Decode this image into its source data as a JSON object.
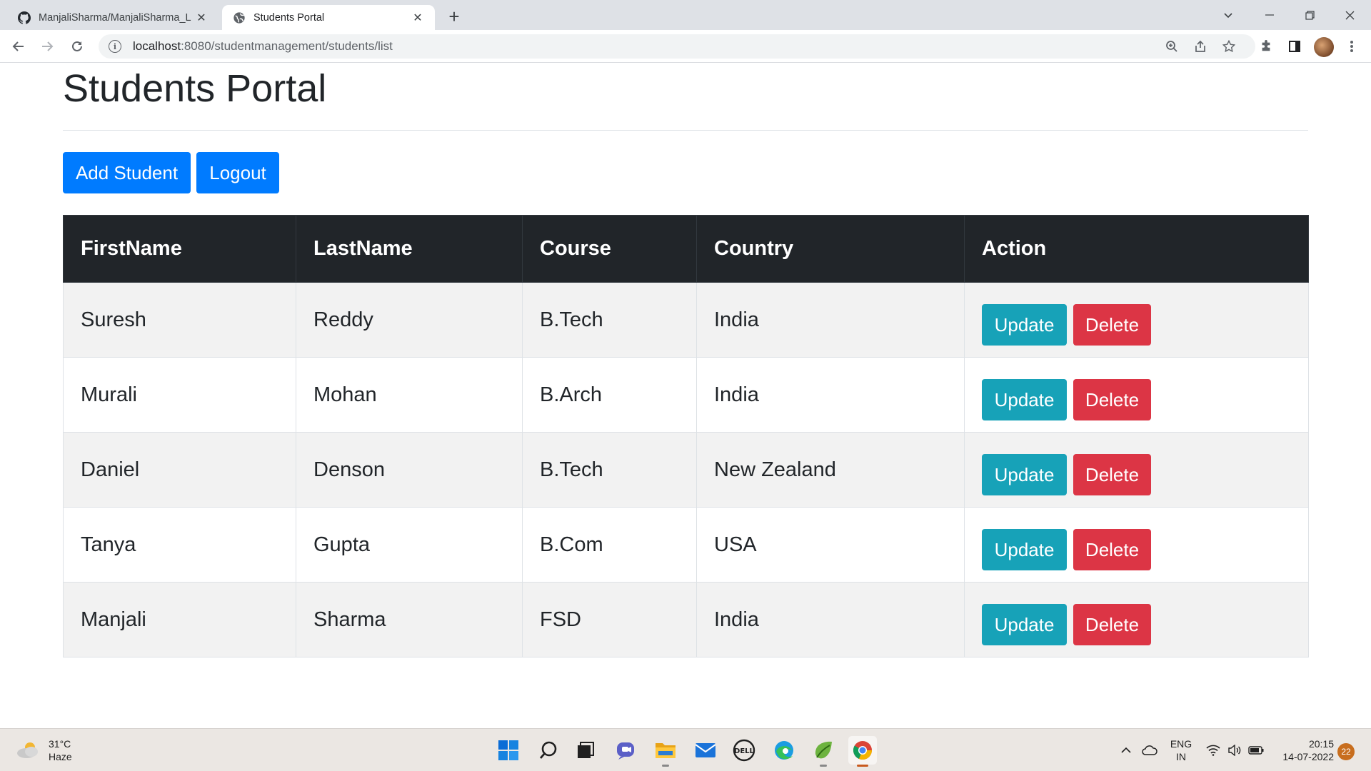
{
  "browser": {
    "tabs": [
      {
        "title": "ManjaliSharma/ManjaliSharma_L",
        "icon": "github-icon",
        "active": false
      },
      {
        "title": "Students Portal",
        "icon": "globe-icon",
        "active": true
      }
    ],
    "url_host": "localhost",
    "url_path": ":8080/studentmanagement/students/list"
  },
  "page": {
    "title": "Students Portal",
    "add_button": "Add Student",
    "logout_button": "Logout",
    "table": {
      "headers": [
        "FirstName",
        "LastName",
        "Course",
        "Country",
        "Action"
      ],
      "rows": [
        {
          "first": "Suresh",
          "last": "Reddy",
          "course": "B.Tech",
          "country": "India"
        },
        {
          "first": "Murali",
          "last": "Mohan",
          "course": "B.Arch",
          "country": "India"
        },
        {
          "first": "Daniel",
          "last": "Denson",
          "course": "B.Tech",
          "country": "New Zealand"
        },
        {
          "first": "Tanya",
          "last": "Gupta",
          "course": "B.Com",
          "country": "USA"
        },
        {
          "first": "Manjali",
          "last": "Sharma",
          "course": "FSD",
          "country": "India"
        }
      ],
      "update_label": "Update",
      "delete_label": "Delete"
    }
  },
  "taskbar": {
    "weather_temp": "31°C",
    "weather_desc": "Haze",
    "lang_top": "ENG",
    "lang_bottom": "IN",
    "time": "20:15",
    "date": "14-07-2022",
    "notification_count": "22"
  },
  "colors": {
    "primary": "#007bff",
    "info": "#17a2b8",
    "danger": "#dc3545",
    "table_header": "#212529"
  }
}
